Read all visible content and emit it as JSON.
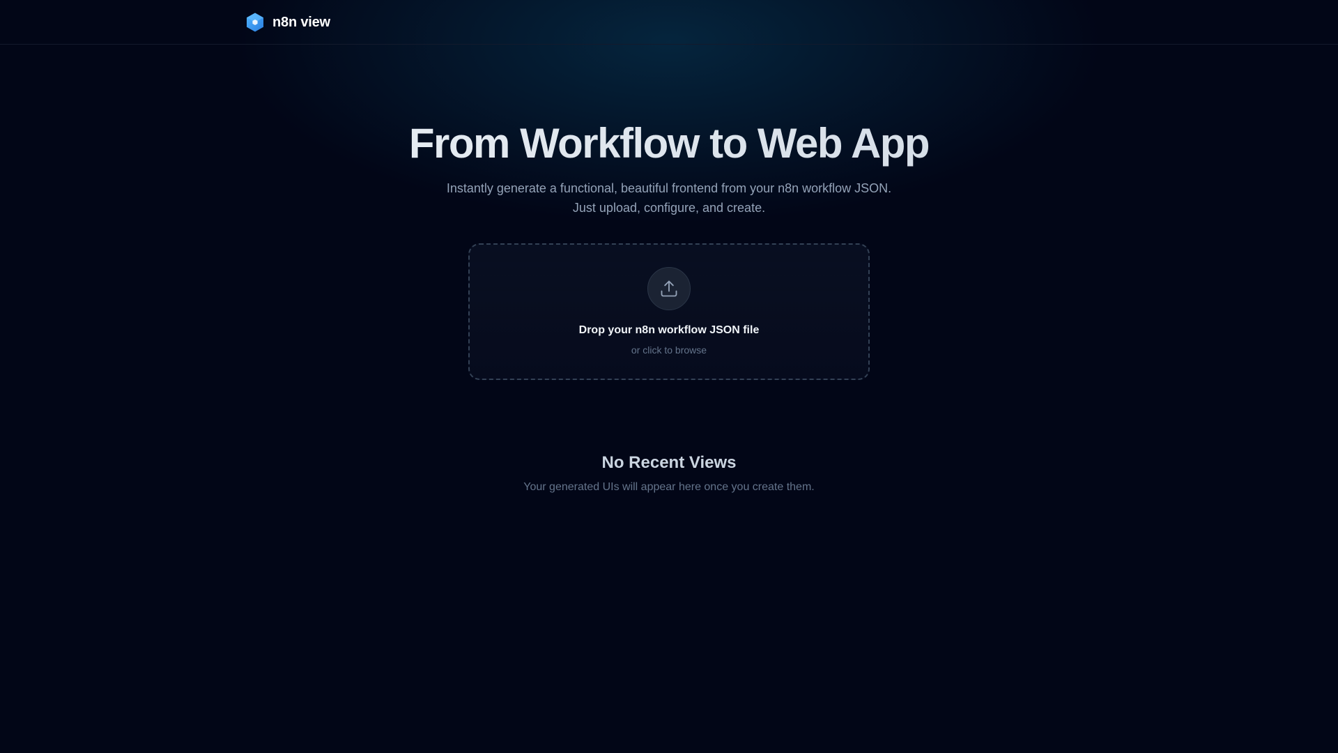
{
  "header": {
    "brand_name": "n8n view",
    "logo_icon": "hexagon-logo-icon",
    "accent_color": "#3b9ff5"
  },
  "hero": {
    "title": "From Workflow to Web App",
    "subtitle_line1": "Instantly generate a functional, beautiful frontend from your n8n workflow JSON.",
    "subtitle_line2": "Just upload, configure, and create."
  },
  "dropzone": {
    "icon": "upload-icon",
    "title": "Drop your n8n workflow JSON file",
    "subtitle": "or click to browse"
  },
  "recent": {
    "title": "No Recent Views",
    "subtitle": "Your generated UIs will appear here once you create them."
  }
}
